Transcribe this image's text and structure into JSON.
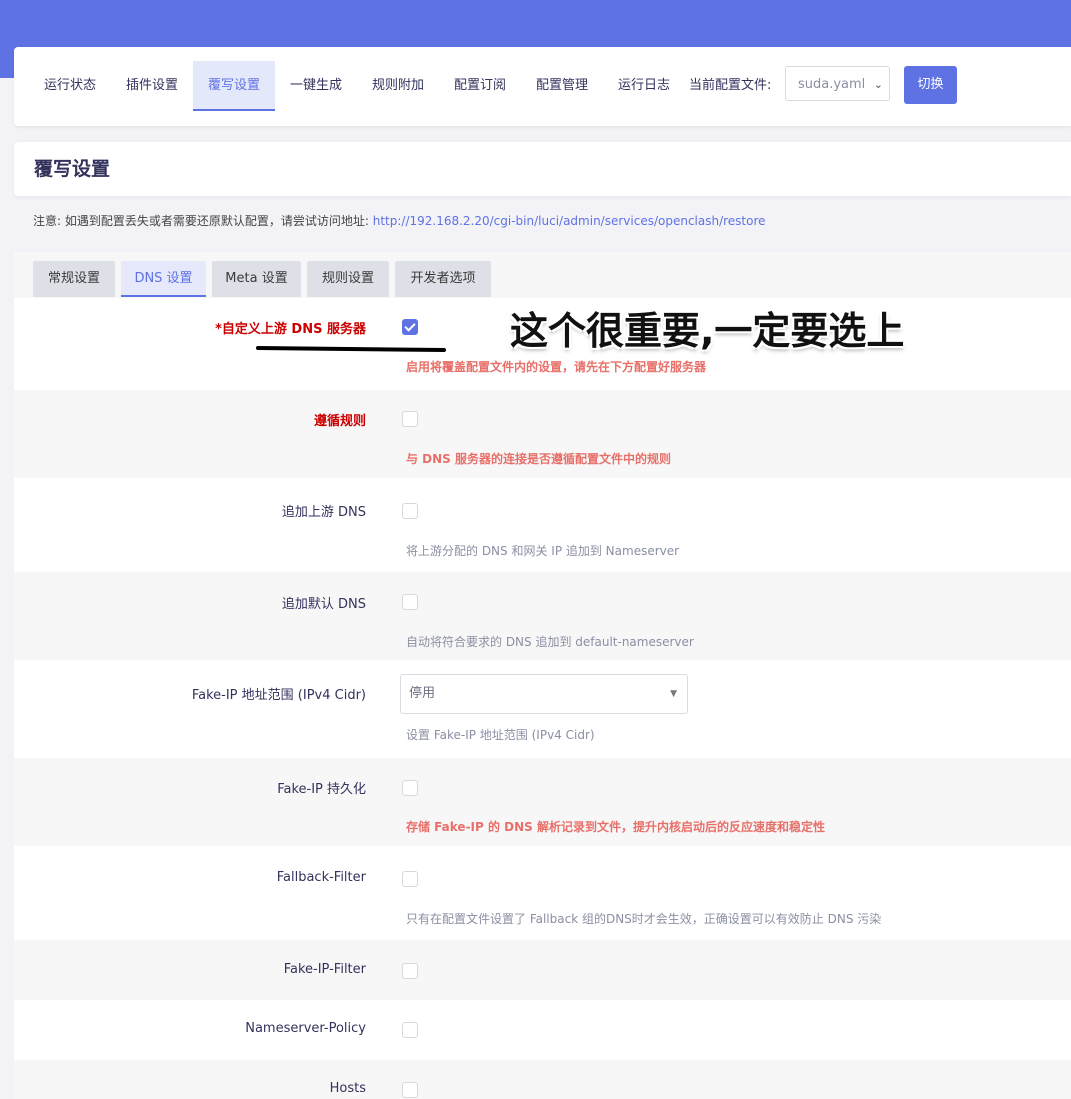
{
  "nav": {
    "tabs": [
      {
        "label": "运行状态"
      },
      {
        "label": "插件设置"
      },
      {
        "label": "覆写设置"
      },
      {
        "label": "一键生成"
      },
      {
        "label": "规则附加"
      },
      {
        "label": "配置订阅"
      },
      {
        "label": "配置管理"
      },
      {
        "label": "运行日志"
      }
    ],
    "active": "覆写设置",
    "config_label": "当前配置文件:",
    "config_value": "suda.yaml",
    "switch_label": "切换"
  },
  "page": {
    "title": "覆写设置",
    "notice_text": "注意: 如遇到配置丢失或者需要还原默认配置，请尝试访问地址: ",
    "notice_link": "http://192.168.2.20/cgi-bin/luci/admin/services/openclash/restore"
  },
  "subtabs": [
    {
      "label": "常规设置"
    },
    {
      "label": "DNS 设置"
    },
    {
      "label": "Meta 设置"
    },
    {
      "label": "规则设置"
    },
    {
      "label": "开发者选项"
    }
  ],
  "settings": [
    {
      "label": "*自定义上游 DNS 服务器",
      "checked": true,
      "desc": "启用将覆盖配置文件内的设置，请先在下方配置好服务器"
    },
    {
      "label": "遵循规则",
      "checked": false,
      "desc": "与 DNS 服务器的连接是否遵循配置文件中的规则"
    },
    {
      "label": "追加上游 DNS",
      "checked": false,
      "desc": "将上游分配的 DNS 和网关 IP 追加到 Nameserver"
    },
    {
      "label": "追加默认 DNS",
      "checked": false,
      "desc": "自动将符合要求的 DNS 追加到 default-nameserver"
    },
    {
      "label": "Fake-IP 地址范围 (IPv4 Cidr)",
      "value": "停用",
      "desc": "设置 Fake-IP 地址范围 (IPv4 Cidr)"
    },
    {
      "label": "Fake-IP 持久化",
      "checked": false,
      "desc": "存储 Fake-IP 的 DNS 解析记录到文件，提升内核启动后的反应速度和稳定性"
    },
    {
      "label": "Fallback-Filter",
      "checked": false,
      "desc": "只有在配置文件设置了 Fallback 组的DNS时才会生效，正确设置可以有效防止 DNS 污染"
    },
    {
      "label": "Fake-IP-Filter",
      "checked": false
    },
    {
      "label": "Nameserver-Policy",
      "checked": false
    },
    {
      "label": "Hosts",
      "checked": false
    }
  ],
  "annotation": "这个很重要,一定要选上",
  "colors": {
    "accent": "#5e72e4",
    "required_label": "#cc0000",
    "warning_desc": "#e8706a"
  }
}
